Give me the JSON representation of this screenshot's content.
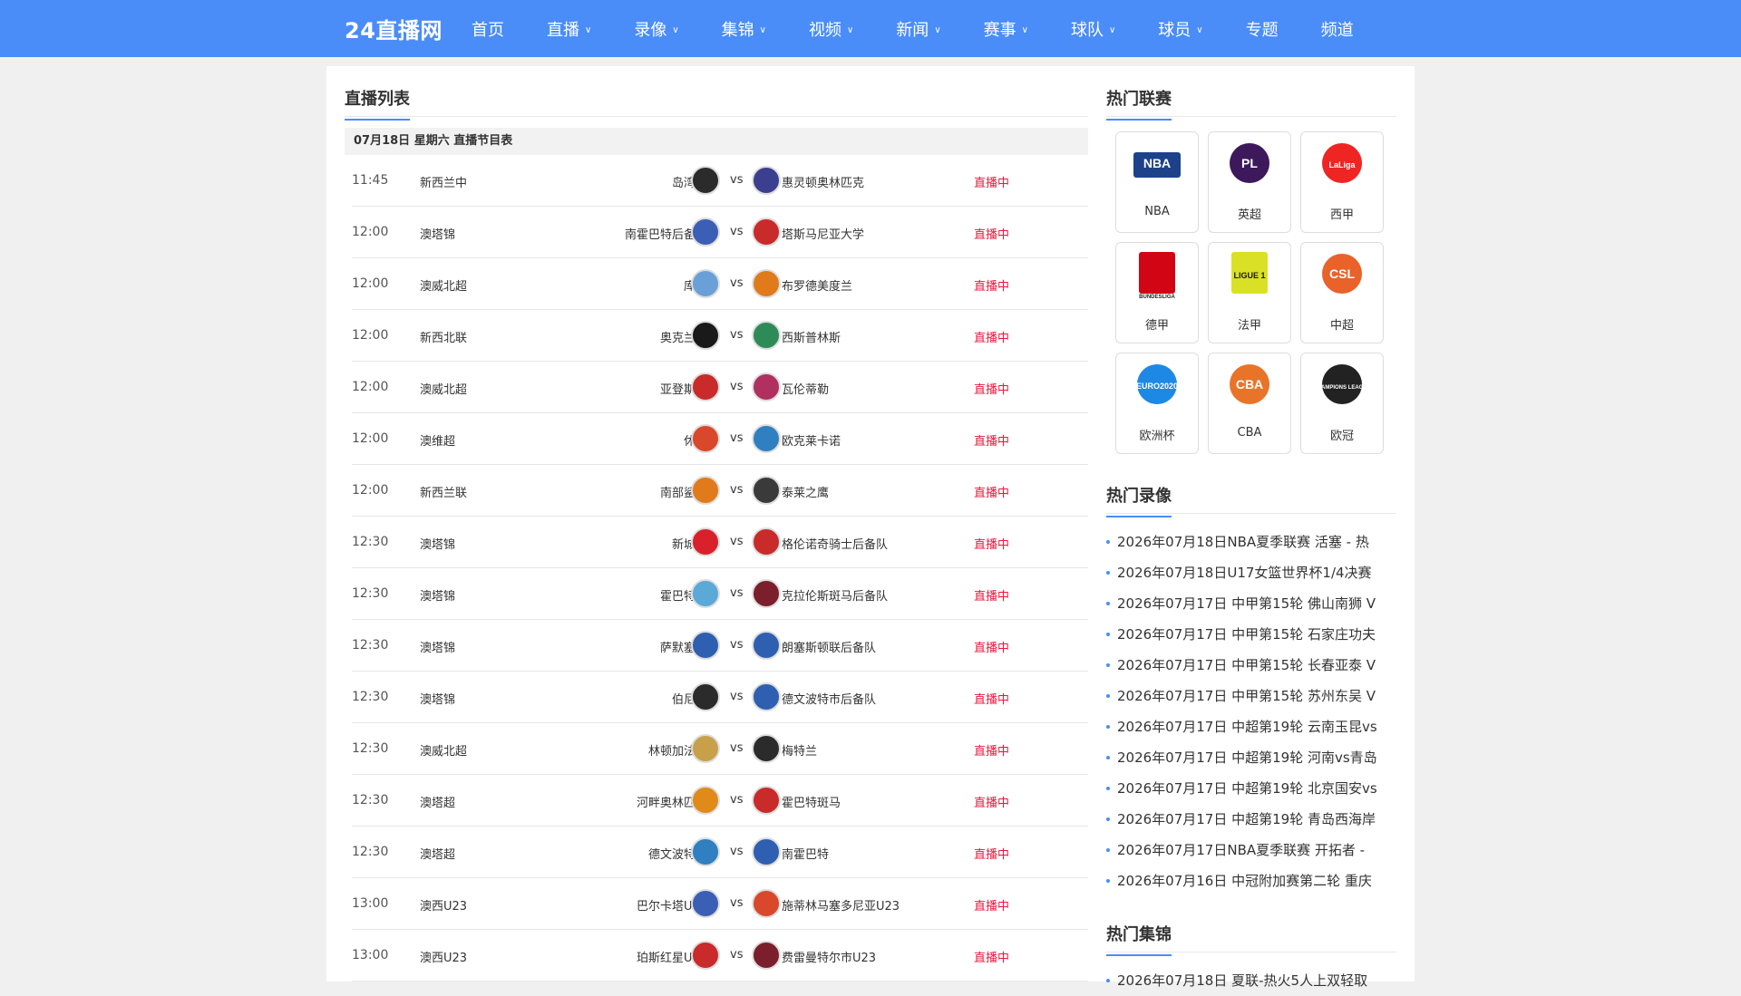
{
  "site": {
    "logo": "24直播网"
  },
  "nav": [
    {
      "label": "首页",
      "dropdown": false
    },
    {
      "label": "直播",
      "dropdown": true
    },
    {
      "label": "录像",
      "dropdown": true
    },
    {
      "label": "集锦",
      "dropdown": true
    },
    {
      "label": "视频",
      "dropdown": true
    },
    {
      "label": "新闻",
      "dropdown": true
    },
    {
      "label": "赛事",
      "dropdown": true
    },
    {
      "label": "球队",
      "dropdown": true
    },
    {
      "label": "球员",
      "dropdown": true
    },
    {
      "label": "专题",
      "dropdown": false
    },
    {
      "label": "频道",
      "dropdown": false
    }
  ],
  "caret": "∨",
  "main": {
    "title": "直播列表",
    "date_bar": "07月18日 星期六 直播节目表",
    "vs": "vs",
    "matches": [
      {
        "time": "11:45",
        "league": "新西兰中",
        "home": "岛湾联",
        "away": "惠灵顿奥林匹克",
        "status": "直播中",
        "home_color": "#2b2b2b",
        "away_color": "#3b3f8f"
      },
      {
        "time": "12:00",
        "league": "澳塔锦",
        "home": "南霍巴特后备队",
        "away": "塔斯马尼亚大学",
        "status": "直播中",
        "home_color": "#3b5fb5",
        "away_color": "#c92a2a"
      },
      {
        "time": "12:00",
        "league": "澳威北超",
        "home": "库山",
        "away": "布罗德美度兰",
        "status": "直播中",
        "home_color": "#6aa0d8",
        "away_color": "#e07a1a"
      },
      {
        "time": "12:00",
        "league": "新西北联",
        "home": "奥克兰联",
        "away": "西斯普林斯",
        "status": "直播中",
        "home_color": "#1a1a1a",
        "away_color": "#2e8b57"
      },
      {
        "time": "12:00",
        "league": "澳威北超",
        "home": "亚登斯顿",
        "away": "瓦伦蒂勒",
        "status": "直播中",
        "home_color": "#c92a2a",
        "away_color": "#b03060"
      },
      {
        "time": "12:00",
        "league": "澳维超",
        "home": "休城",
        "away": "欧克莱卡诺",
        "status": "直播中",
        "home_color": "#d9482b",
        "away_color": "#2f7fc1"
      },
      {
        "time": "12:00",
        "league": "新西兰联",
        "home": "南部鲨鱼",
        "away": "泰莱之鹰",
        "status": "直播中",
        "home_color": "#e07a1a",
        "away_color": "#3a3a3a"
      },
      {
        "time": "12:30",
        "league": "澳塔锦",
        "home": "新城鷹",
        "away": "格伦诺奇骑士后备队",
        "status": "直播中",
        "home_color": "#d9212b",
        "away_color": "#c92a2a"
      },
      {
        "time": "12:30",
        "league": "澳塔锦",
        "home": "霍巴特城",
        "away": "克拉伦斯斑马后备队",
        "status": "直播中",
        "home_color": "#5aa9d6",
        "away_color": "#7a1f2b"
      },
      {
        "time": "12:30",
        "league": "澳塔锦",
        "home": "萨默塞特",
        "away": "朗塞斯顿联后备队",
        "status": "直播中",
        "home_color": "#2f5fb0",
        "away_color": "#2f5fb0"
      },
      {
        "time": "12:30",
        "league": "澳塔锦",
        "home": "伯尼联",
        "away": "德文波特市后备队",
        "status": "直播中",
        "home_color": "#2b2b2b",
        "away_color": "#2f5fb0"
      },
      {
        "time": "12:30",
        "league": "澳威北超",
        "home": "林顿加法斯",
        "away": "梅特兰",
        "status": "直播中",
        "home_color": "#c8a04a",
        "away_color": "#2b2b2b"
      },
      {
        "time": "12:30",
        "league": "澳塔超",
        "home": "河畔奥林匹克",
        "away": "霍巴特斑马",
        "status": "直播中",
        "home_color": "#e08a1a",
        "away_color": "#c92a2a"
      },
      {
        "time": "12:30",
        "league": "澳塔超",
        "home": "德文波特城",
        "away": "南霍巴特",
        "status": "直播中",
        "home_color": "#2f7fc1",
        "away_color": "#2f5fb0"
      },
      {
        "time": "13:00",
        "league": "澳西U23",
        "home": "巴尔卡塔U23",
        "away": "施蒂林马塞多尼亚U23",
        "status": "直播中",
        "home_color": "#3b5fb5",
        "away_color": "#d9482b"
      },
      {
        "time": "13:00",
        "league": "澳西U23",
        "home": "珀斯红星U23",
        "away": "费雷曼特尔市U23",
        "status": "直播中",
        "home_color": "#c92a2a",
        "away_color": "#7a1f2b"
      }
    ]
  },
  "sidebar": {
    "hot_leagues_title": "热门联赛",
    "leagues": [
      {
        "name": "NBA",
        "logo_text": "NBA",
        "color": "#1d428a",
        "accent": "#c8102e"
      },
      {
        "name": "英超",
        "logo_text": "PL",
        "color": "#3d195b",
        "accent": "#3d195b"
      },
      {
        "name": "西甲",
        "logo_text": "LaLiga",
        "color": "#ee2523",
        "accent": "#222"
      },
      {
        "name": "德甲",
        "logo_text": "BUNDESLIGA",
        "color": "#d20515",
        "accent": "#222"
      },
      {
        "name": "法甲",
        "logo_text": "LIGUE 1",
        "color": "#dae025",
        "accent": "#1a1a1a"
      },
      {
        "name": "中超",
        "logo_text": "CSL",
        "color": "#e8622a",
        "accent": "#d6262f"
      },
      {
        "name": "欧洲杯",
        "logo_text": "EURO2020",
        "color": "#1e88e5",
        "accent": "#2b8a3e"
      },
      {
        "name": "CBA",
        "logo_text": "CBA",
        "color": "#e8742a",
        "accent": "#222"
      },
      {
        "name": "欧冠",
        "logo_text": "CHAMPIONS LEAGUE",
        "color": "#222",
        "accent": "#222"
      }
    ],
    "hot_replays_title": "热门录像",
    "replays": [
      "2026年07月18日NBA夏季联赛 活塞 - 热",
      "2026年07月18日U17女篮世界杯1/4决赛",
      "2026年07月17日 中甲第15轮 佛山南狮 V",
      "2026年07月17日 中甲第15轮 石家庄功夫",
      "2026年07月17日 中甲第15轮 长春亚泰 V",
      "2026年07月17日 中甲第15轮 苏州东吴 V",
      "2026年07月17日 中超第19轮 云南玉昆vs",
      "2026年07月17日 中超第19轮 河南vs青岛",
      "2026年07月17日 中超第19轮 北京国安vs",
      "2026年07月17日 中超第19轮 青岛西海岸",
      "2026年07月17日NBA夏季联赛 开拓者 -",
      "2026年07月16日 中冠附加赛第二轮 重庆"
    ],
    "hot_highlights_title": "热门集锦",
    "highlights": [
      "2026年07月18日 夏联-热火5人上双轻取"
    ]
  }
}
